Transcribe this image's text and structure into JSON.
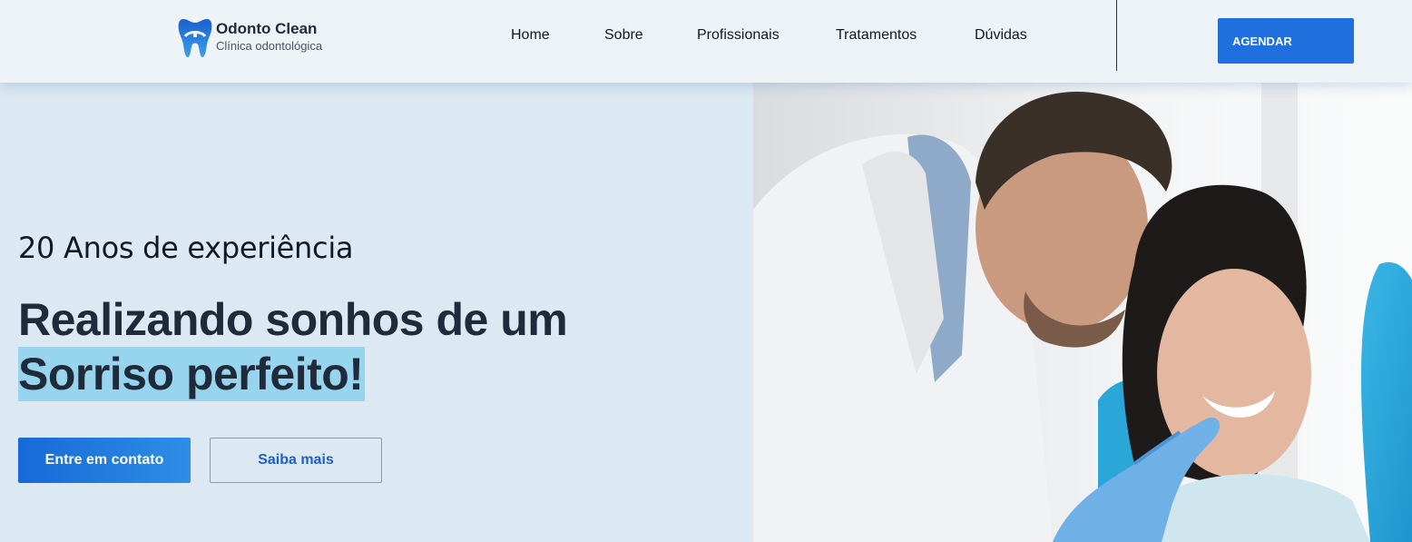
{
  "header": {
    "brand_name": "Odonto Clean",
    "brand_subtitle": "Clínica odontológica",
    "logo_icon": "tooth-icon",
    "nav": [
      {
        "label": "Home"
      },
      {
        "label": "Sobre"
      },
      {
        "label": "Profissionais"
      },
      {
        "label": "Tratamentos"
      },
      {
        "label": "Dúvidas"
      }
    ],
    "cta_label": "AGENDAR"
  },
  "hero": {
    "eyebrow": "20 Anos de experiência",
    "headline_line1": "Realizando sonhos de um",
    "headline_line2": "Sorriso perfeito!",
    "primary_button": "Entre em contato",
    "secondary_button": "Saiba mais",
    "photo": "dentist-with-smiling-patient-photo"
  },
  "colors": {
    "accent": "#1f6fde",
    "hero_background": "#dce8f2",
    "header_background": "#eef3f8",
    "highlight": "#97d5ef",
    "heading_text": "#1f2a3a"
  }
}
